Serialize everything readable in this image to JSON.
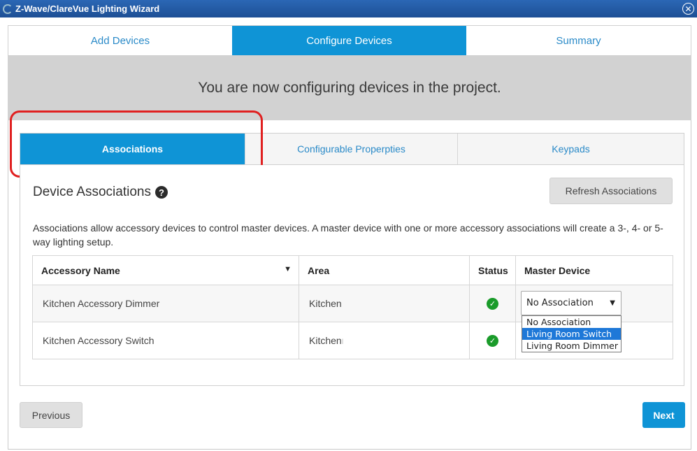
{
  "window": {
    "title": "Z-Wave/ClareVue Lighting Wizard",
    "close_icon": "close-icon"
  },
  "steps": [
    {
      "label": "Add Devices",
      "active": false
    },
    {
      "label": "Configure Devices",
      "active": true
    },
    {
      "label": "Summary",
      "active": false
    }
  ],
  "banner": {
    "text": "You are now configuring devices in the project."
  },
  "subtabs": [
    {
      "label": "Associations",
      "active": true
    },
    {
      "label": "Configurable Properpties",
      "active": false
    },
    {
      "label": "Keypads",
      "active": false
    }
  ],
  "section": {
    "title": "Device Associations",
    "help_icon": "question-circle-icon",
    "refresh_label": "Refresh Associations",
    "description": "Associations allow accessory devices to control master devices. A master device with one or more accessory associations will create a 3-, 4- or 5-way lighting setup."
  },
  "table": {
    "headers": {
      "name": "Accessory Name",
      "area": "Area",
      "status": "Status",
      "master": "Master Device"
    },
    "sort_icon": "caret-down-icon",
    "rows": [
      {
        "name": "Kitchen Accessory Dimmer",
        "area": "Kitchen",
        "status": "ok"
      },
      {
        "name": "Kitchen Accessory Switch",
        "area": "Kitchen",
        "status": "ok"
      }
    ]
  },
  "master_select": {
    "value": "No Association",
    "options": [
      "No Association",
      "Living Room Switch",
      "Living Room Dimmer"
    ],
    "highlighted": "Living Room Switch"
  },
  "footer": {
    "previous_label": "Previous",
    "next_label": "Next"
  },
  "colors": {
    "accent": "#0f94d6",
    "titlebar": "#1d4f95",
    "status_ok": "#1a9b2a",
    "highlight_annotation": "#e02020"
  }
}
